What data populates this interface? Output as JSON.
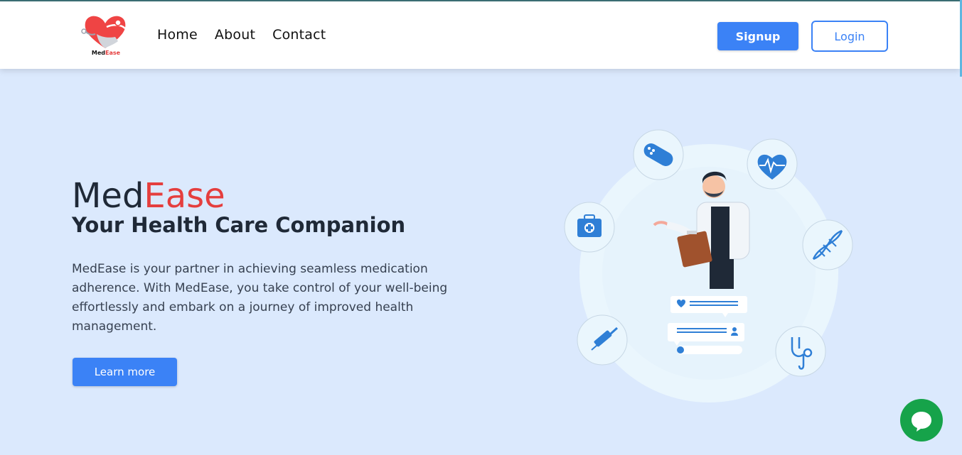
{
  "header": {
    "logo": {
      "text_part1": "Med",
      "text_part2": "Ease"
    },
    "nav": [
      {
        "label": "Home"
      },
      {
        "label": "About"
      },
      {
        "label": "Contact"
      }
    ],
    "signup_label": "Signup",
    "login_label": "Login"
  },
  "hero": {
    "title_part1": "Med",
    "title_part2": "Ease",
    "subtitle": "Your Health Care Companion",
    "description": "MedEase is your partner in achieving seamless medication adherence. With MedEase, you take control of your well-being effortlessly and embark on a journey of improved health management.",
    "cta_label": "Learn more"
  },
  "illustration": {
    "icons": [
      "bandage-icon",
      "heart-pulse-icon",
      "first-aid-kit-icon",
      "dna-icon",
      "syringe-icon",
      "stethoscope-icon"
    ]
  },
  "colors": {
    "primary": "#3b82f6",
    "accent": "#e53e3e",
    "background": "#dbe9fd",
    "chat": "#16a34a"
  },
  "chat": {
    "icon": "chat-icon"
  }
}
